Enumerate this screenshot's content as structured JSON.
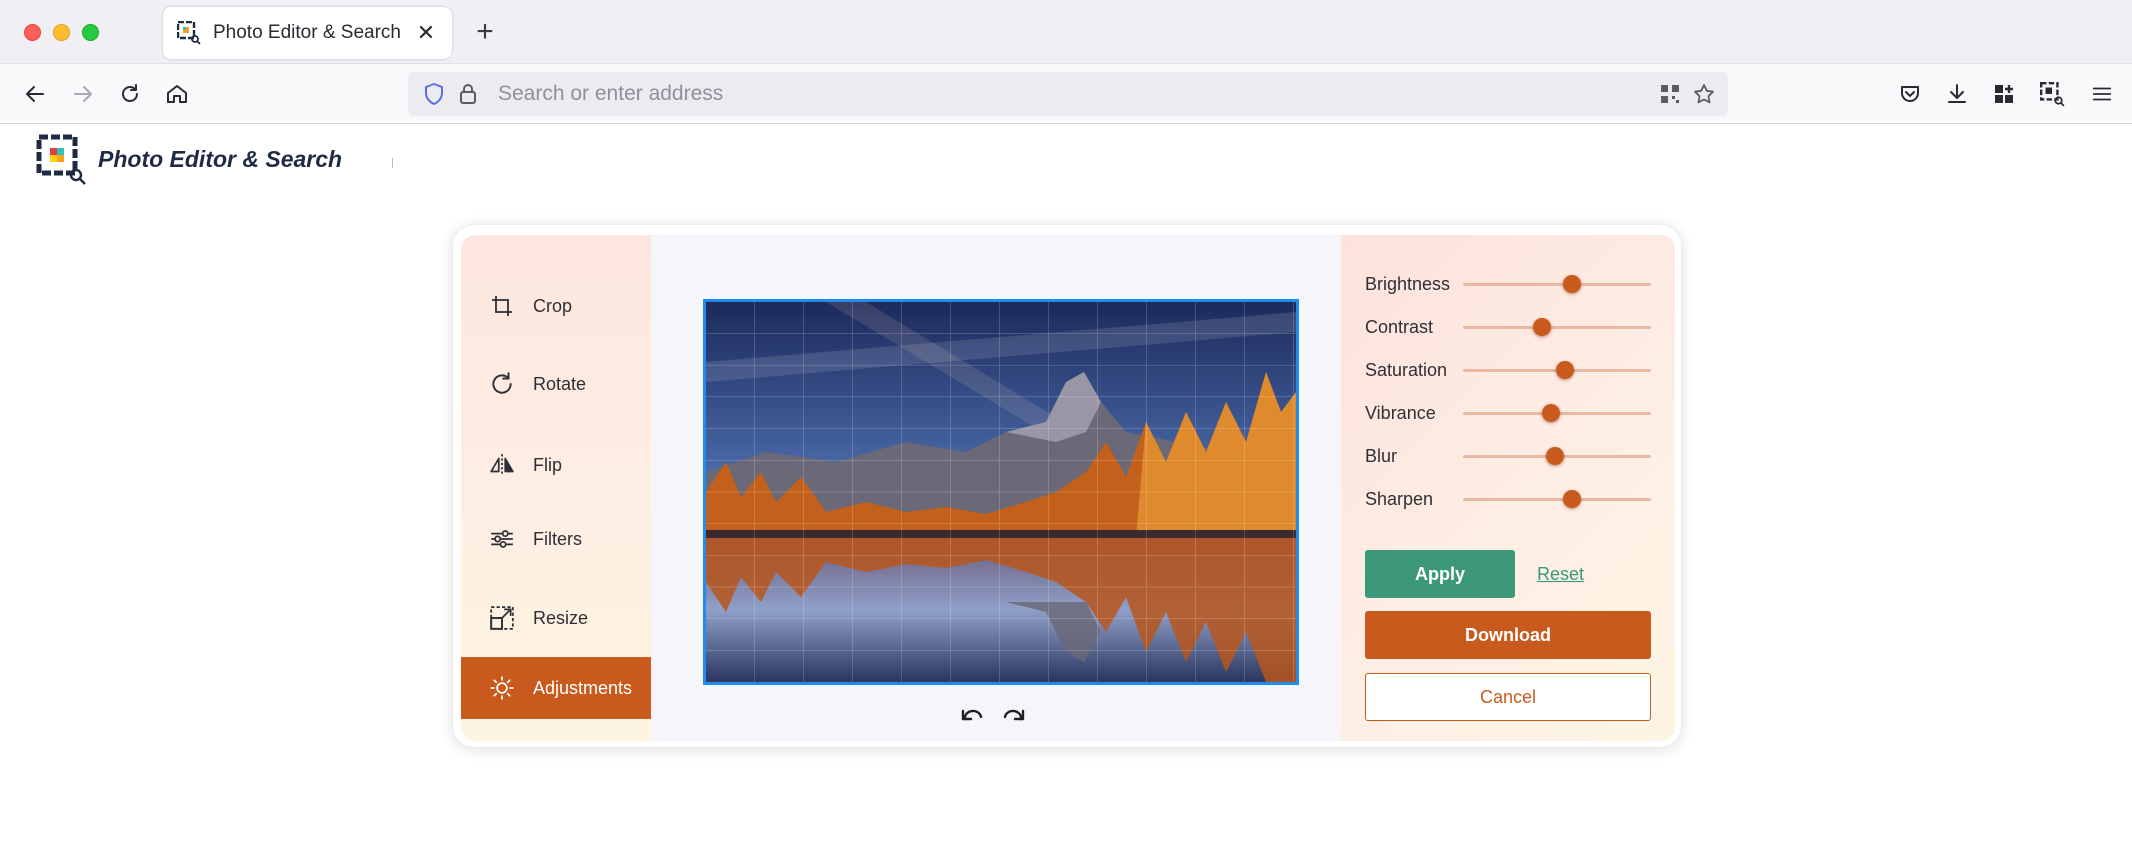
{
  "browser": {
    "tab_title": "Photo Editor & Search",
    "address_placeholder": "Search or enter address"
  },
  "header": {
    "brand": "Photo Editor & Search"
  },
  "tools": [
    {
      "label": "Crop",
      "icon": "crop-icon"
    },
    {
      "label": "Rotate",
      "icon": "rotate-icon"
    },
    {
      "label": "Flip",
      "icon": "flip-icon"
    },
    {
      "label": "Filters",
      "icon": "filters-icon"
    },
    {
      "label": "Resize",
      "icon": "resize-icon"
    },
    {
      "label": "Adjustments",
      "icon": "sun-icon",
      "active": true
    }
  ],
  "adjustments": [
    {
      "label": "Brightness",
      "value": 0.58
    },
    {
      "label": "Contrast",
      "value": 0.42
    },
    {
      "label": "Saturation",
      "value": 0.54
    },
    {
      "label": "Vibrance",
      "value": 0.47
    },
    {
      "label": "Blur",
      "value": 0.49
    },
    {
      "label": "Sharpen",
      "value": 0.58
    }
  ],
  "actions": {
    "apply": "Apply",
    "reset": "Reset",
    "download": "Download",
    "cancel": "Cancel"
  },
  "colors": {
    "accent": "#c85a1e",
    "apply": "#3d9879",
    "selection": "#1f8cf0"
  }
}
